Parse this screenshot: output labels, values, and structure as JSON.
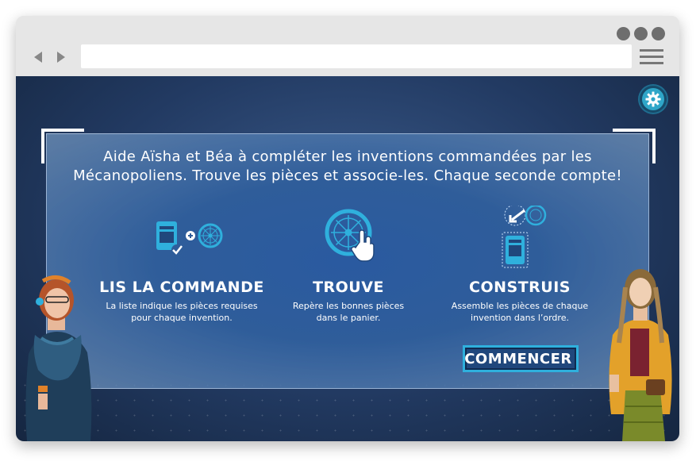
{
  "game": {
    "intro_line1": "Aide Aïsha et Béa à compléter les inventions commandées par les",
    "intro_line2": "Mécanopoliens. Trouve les pièces et associe-les. Chaque seconde compte!",
    "steps": [
      {
        "title": "LIS LA COMMANDE",
        "desc_line1": "La liste indique les pièces requises",
        "desc_line2": "pour chaque invention."
      },
      {
        "title": "TROUVE",
        "desc_line1": "Repère les bonnes pièces",
        "desc_line2": "dans le panier."
      },
      {
        "title": "CONSTRUIS",
        "desc_line1": "Assemble les pièces de chaque",
        "desc_line2": "invention dans l’ordre."
      }
    ],
    "start_label": "COMMENCER"
  },
  "colors": {
    "accent": "#2fb0dd",
    "panel": "#2f5d9a",
    "button_bg": "#20477c"
  },
  "icons": [
    "back-arrow-icon",
    "forward-arrow-icon",
    "hamburger-menu-icon",
    "gear-icon",
    "order-card-icon",
    "checkmark-icon",
    "plus-icon",
    "wheel-icon",
    "hand-pointer-icon",
    "arrow-icon",
    "arrow-right-icon"
  ]
}
